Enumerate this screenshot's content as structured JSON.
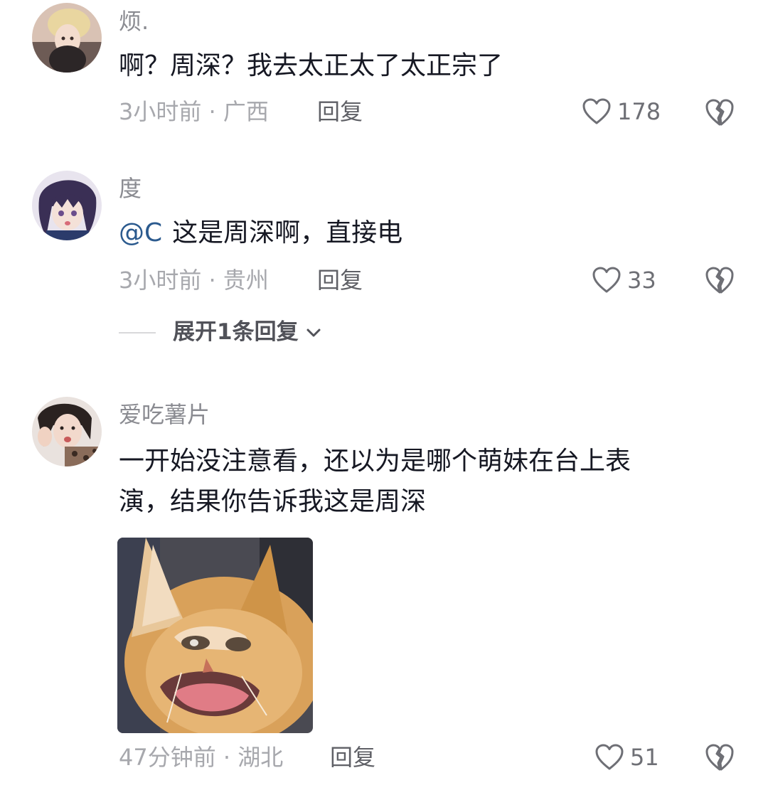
{
  "comments": [
    {
      "username": "烦.",
      "text": "啊？周深？我去太正太了太正宗了",
      "time": "3小时前",
      "location": "广西",
      "reply_label": "回复",
      "likes": "178"
    },
    {
      "username": "度",
      "mention": "@C",
      "text": "这是周深啊，直接电",
      "time": "3小时前",
      "location": "贵州",
      "reply_label": "回复",
      "likes": "33",
      "expand_label": "展开1条回复"
    },
    {
      "username": "爱吃薯片",
      "text_line1": "一开始没注意看，还以为是哪个萌妹在台上表",
      "text_line2": "演，结果你告诉我这是周深",
      "time": "47分钟前",
      "location": "湖北",
      "reply_label": "回复",
      "likes": "51",
      "sticker": "cat-meme-sticker"
    }
  ],
  "separator": " · ",
  "icons": {
    "like": "heart-outline-icon",
    "dislike": "broken-heart-icon",
    "expand": "chevron-down-icon"
  },
  "colors": {
    "username": "#8a8b91",
    "meta": "#a7a8ad",
    "mention": "#2b5a8e",
    "text": "#161823"
  }
}
